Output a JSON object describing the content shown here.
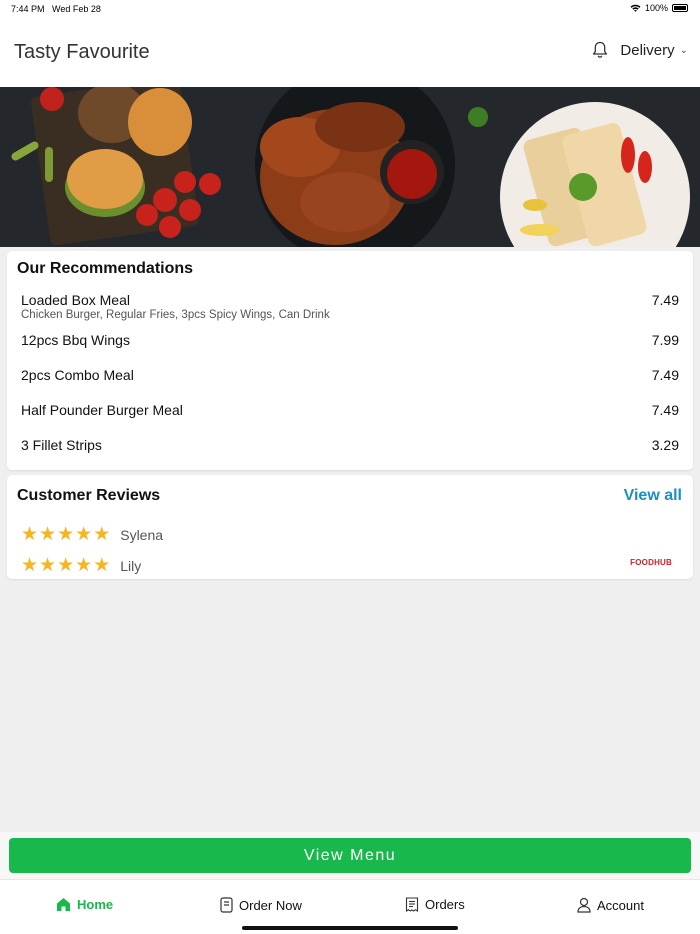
{
  "status_bar": {
    "time": "7:44 PM",
    "date": "Wed Feb 28",
    "battery": "100%"
  },
  "header": {
    "title": "Tasty Favourite",
    "order_mode": "Delivery"
  },
  "recommendations": {
    "title": "Our Recommendations",
    "items": [
      {
        "name": "Loaded Box Meal",
        "description": "Chicken Burger, Regular Fries, 3pcs Spicy Wings, Can Drink",
        "price": "7.49"
      },
      {
        "name": "12pcs Bbq Wings",
        "description": "",
        "price": "7.99"
      },
      {
        "name": "2pcs Combo Meal",
        "description": "",
        "price": "7.49"
      },
      {
        "name": "Half Pounder Burger Meal",
        "description": "",
        "price": "7.49"
      },
      {
        "name": "3 Fillet Strips",
        "description": "",
        "price": "3.29"
      }
    ]
  },
  "reviews": {
    "title": "Customer Reviews",
    "view_all": "View all",
    "items": [
      {
        "name": "Sylena",
        "rating": 5
      },
      {
        "name": "Lily",
        "rating": 5
      }
    ],
    "logo_text": "FOODHUB"
  },
  "view_menu_label": "View Menu",
  "tabs": [
    {
      "label": "Home",
      "icon": "home-icon",
      "active": true
    },
    {
      "label": "Order Now",
      "icon": "order-now-icon",
      "active": false
    },
    {
      "label": "Orders",
      "icon": "receipt-icon",
      "active": false
    },
    {
      "label": "Account",
      "icon": "user-icon",
      "active": false
    }
  ],
  "colors": {
    "accent_green": "#18b84d",
    "link_blue": "#1a8fc4",
    "star": "#f5b623",
    "brand_red": "#d0202a"
  }
}
